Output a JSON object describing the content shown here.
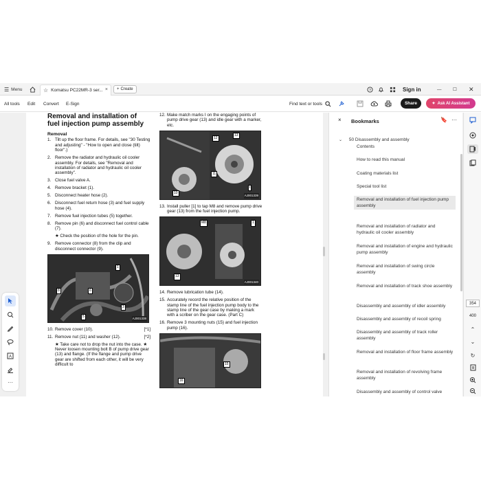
{
  "titlebar": {
    "menu_label": "Menu",
    "tab_title": "Komatsu PC22MR-3 ser...",
    "create_label": "Create",
    "signin_label": "Sign in"
  },
  "toolbar": {
    "all_tools": "All tools",
    "edit": "Edit",
    "convert": "Convert",
    "esign": "E-Sign",
    "find_label": "Find text or tools",
    "share_label": "Share",
    "ai_label": "Ask AI Assistant"
  },
  "document": {
    "title": "Removal and installation of fuel injection pump assembly",
    "section": "Removal",
    "left_steps": [
      {
        "n": "1.",
        "t": "Tilt up the floor frame. For details, see \"30 Testing and adjusting\" - \"How to open and close (tilt) floor\".)"
      },
      {
        "n": "2.",
        "t": "Remove the radiator and hydraulic oil cooler assembly. For details, see \"Removal and installation of radiator and hydraulic oil cooler assembly\"."
      },
      {
        "n": "3.",
        "t": "Close fuel valve A."
      },
      {
        "n": "4.",
        "t": "Remove bracket (1)."
      },
      {
        "n": "5.",
        "t": "Disconnect heater hose (2)."
      },
      {
        "n": "6.",
        "t": "Disconnect fuel return hose (3) and fuel supply hose (4)."
      },
      {
        "n": "7.",
        "t": "Remove fuel injection tubes (5) together."
      },
      {
        "n": "8.",
        "t": "Remove pin (6) and disconnect fuel control cable (7)."
      },
      {
        "n": "",
        "t": "★ Check the position of the hole for the pin."
      },
      {
        "n": "9.",
        "t": "Remove connector (8) from the clip and disconnect connector (9)."
      }
    ],
    "left_photo_label": "AJ001338",
    "left_after": [
      {
        "n": "10.",
        "t": "Remove cover (10).",
        "r": "[*1]"
      },
      {
        "n": "11.",
        "t": "Remove nut (11) and washer (12).",
        "r": "[*2]"
      }
    ],
    "left_notes": "★ Take care not to drop the nut into the case. ★ Never loosen mounting bolt B of pump drive gear (13) and flange. (If the flange and pump drive gear are shifted from each other, it will be very difficult to",
    "right_step12": {
      "n": "12.",
      "t": "Make match marks I on the engaging points of pump drive gear (13) and idle gear with a marker, etc."
    },
    "right_photo1_label": "AJ001339",
    "right_step13": {
      "n": "13.",
      "t": "Install puller [1] to tap M8 and remove pump drive gear (13) from the fuel injection pump."
    },
    "right_photo2_label": "AJ001340",
    "right_steps": [
      {
        "n": "14.",
        "t": "Remove lubrication tube (14)."
      },
      {
        "n": "15.",
        "t": "Accurately record the relative position of the stamp line of the fuel injection pump body to the stamp line of the gear case by making a mark with a scriber on the gear case. (Part C)"
      },
      {
        "n": "16.",
        "t": "Remove 3 mounting nuts (15) and fuel injection pump (16)."
      }
    ]
  },
  "bookmarks": {
    "title": "Bookmarks",
    "parent": "50 Disassembly and assembly",
    "items": [
      "Contents",
      "How to read this manual",
      "Coating materials list",
      "Special tool list",
      "Removal and installation of fuel injection pump assembly",
      "Removal and installation of radiator and hydraulic oil cooler assembly",
      "Removal and installation of engine and hydraulic pump assembly",
      "Removal and installation of swing circle assembly",
      "Removal and installation of track shoe assembly",
      "Disassembly and assembly of idler assembly",
      "Disassembly and assembly of recoil spring",
      "Disassembly and assembly of track roller assembly",
      "Removal and installation of floor frame assembly",
      "Removal and installation of revolving frame assembly",
      "Disassembly and assembly of control valve"
    ],
    "selected_index": 4
  },
  "pager": {
    "current": "354",
    "total": "400"
  },
  "colors": {
    "accent": "#1f5fd1",
    "ai_gradient_start": "#e0456a",
    "ai_gradient_end": "#d23a8f",
    "selected_bg": "#e9e9e9"
  }
}
